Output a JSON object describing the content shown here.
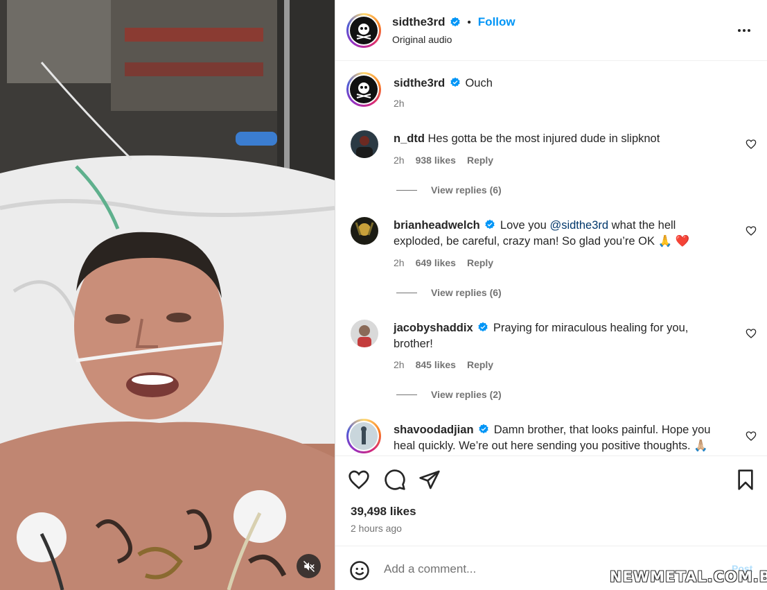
{
  "post": {
    "username": "sidthe3rd",
    "separator": "•",
    "follow_label": "Follow",
    "subtitle": "Original audio"
  },
  "caption": {
    "username": "sidthe3rd",
    "text": "Ouch",
    "time": "2h"
  },
  "comments": [
    {
      "username": "n_dtd",
      "verified": false,
      "text": "Hes gotta be the most injured dude in slipknot",
      "time": "2h",
      "likes": "938 likes",
      "reply": "Reply",
      "view_replies": "View replies (6)"
    },
    {
      "username": "brianheadwelch",
      "verified": true,
      "text_before": "Love you ",
      "mention": "@sidthe3rd",
      "text_after": " what the hell exploded, be careful, crazy man! So glad you’re OK 🙏 ❤️",
      "time": "2h",
      "likes": "649 likes",
      "reply": "Reply",
      "view_replies": "View replies (6)"
    },
    {
      "username": "jacobyshaddix",
      "verified": true,
      "text": "Praying for miraculous healing for you, brother!",
      "time": "2h",
      "likes": "845 likes",
      "reply": "Reply",
      "view_replies": "View replies (2)"
    },
    {
      "username": "shavoodadjian",
      "verified": true,
      "text": "Damn brother, that looks painful. Hope you heal quickly. We’re out here sending you positive thoughts. 🙏🏼"
    }
  ],
  "footer": {
    "likes_count": "39,498 likes",
    "time_ago": "2 hours ago",
    "comment_placeholder": "Add a comment...",
    "post_label": "Post"
  },
  "watermark": "NEWMETAL.COM.BR",
  "colors": {
    "accent": "#0095f6",
    "verified": "#0095f6",
    "text": "#262626",
    "secondary": "#737373"
  }
}
